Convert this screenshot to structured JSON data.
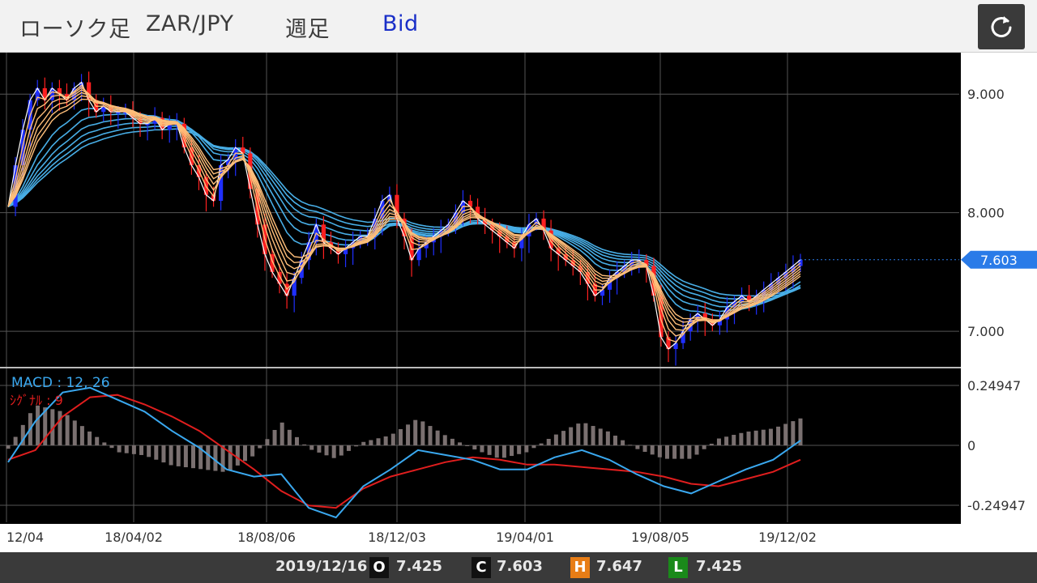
{
  "header": {
    "chart_type": "ローソク足",
    "pair": "ZAR/JPY",
    "period": "週足",
    "side": "Bid"
  },
  "colors": {
    "up_candle": "#1f2fff",
    "down_candle": "#ff2020",
    "fast_ema": "#ffbf7a",
    "slow_ema": "#48aee6",
    "macd_line": "#3aa8ef",
    "signal_line": "#e01e1e",
    "histogram": "#7a7070",
    "price_tag": "#2a7be8"
  },
  "chart_data": [
    {
      "type": "candlestick",
      "x_tick_labels": [
        "12/04",
        "18/04/02",
        "18/08/06",
        "18/12/03",
        "19/04/01",
        "19/08/05",
        "19/12/02"
      ],
      "y_ticks": [
        7.0,
        8.0,
        9.0
      ],
      "y_tick_labels": [
        "7.000",
        "8.000",
        "9.000"
      ],
      "ylim": [
        6.7,
        9.35
      ],
      "current_price": 7.603,
      "current_price_label": "7.603",
      "overlays": [
        "short-term EMAs (orange ribbon)",
        "long-term EMAs (blue ribbon)"
      ],
      "close_path": [
        8.05,
        8.4,
        8.7,
        8.95,
        9.05,
        8.95,
        9.05,
        9.0,
        8.95,
        9.05,
        9.1,
        8.95,
        8.85,
        8.9,
        8.85,
        8.85,
        8.85,
        8.8,
        8.75,
        8.75,
        8.8,
        8.7,
        8.75,
        8.75,
        8.55,
        8.4,
        8.3,
        8.15,
        8.1,
        8.4,
        8.45,
        8.55,
        8.5,
        8.2,
        7.9,
        7.65,
        7.5,
        7.4,
        7.3,
        7.45,
        7.6,
        7.75,
        7.9,
        7.75,
        7.7,
        7.65,
        7.7,
        7.75,
        7.8,
        7.8,
        7.95,
        8.1,
        8.15,
        7.95,
        7.8,
        7.6,
        7.7,
        7.75,
        7.8,
        7.85,
        7.9,
        8.0,
        8.1,
        8.05,
        7.95,
        7.9,
        7.85,
        7.8,
        7.75,
        7.7,
        7.8,
        7.9,
        7.95,
        7.85,
        7.7,
        7.65,
        7.6,
        7.55,
        7.5,
        7.4,
        7.3,
        7.35,
        7.45,
        7.5,
        7.55,
        7.6,
        7.6,
        7.55,
        7.3,
        6.95,
        6.85,
        6.9,
        7.0,
        7.1,
        7.15,
        7.1,
        7.05,
        7.1,
        7.2,
        7.25,
        7.3,
        7.25,
        7.3,
        7.35,
        7.4,
        7.45,
        7.5,
        7.55,
        7.603
      ]
    },
    {
      "type": "line",
      "title": "MACD : 12, 26",
      "signal_label": "ｼｸﾞﾅﾙ : 9",
      "y_ticks": [
        0.24947,
        0,
        -0.24947
      ],
      "y_tick_labels": [
        "0.24947",
        "0",
        "-0.24947"
      ],
      "ylim": [
        -0.32,
        0.32
      ],
      "series": [
        {
          "name": "MACD",
          "values": [
            -0.07,
            0.1,
            0.22,
            0.24,
            0.19,
            0.14,
            0.06,
            -0.01,
            -0.1,
            -0.13,
            -0.12,
            -0.26,
            -0.3,
            -0.17,
            -0.1,
            -0.02,
            -0.04,
            -0.06,
            -0.1,
            -0.1,
            -0.05,
            -0.02,
            -0.06,
            -0.12,
            -0.17,
            -0.2,
            -0.15,
            -0.1,
            -0.06,
            0.02
          ]
        },
        {
          "name": "シグナル",
          "values": [
            -0.06,
            -0.02,
            0.12,
            0.2,
            0.21,
            0.17,
            0.12,
            0.06,
            -0.02,
            -0.1,
            -0.19,
            -0.25,
            -0.26,
            -0.18,
            -0.13,
            -0.1,
            -0.07,
            -0.05,
            -0.06,
            -0.08,
            -0.08,
            -0.09,
            -0.1,
            -0.11,
            -0.13,
            -0.16,
            -0.17,
            -0.14,
            -0.11,
            -0.06
          ]
        }
      ]
    }
  ],
  "footer": {
    "date": "2019/12/16",
    "open_badge": "O",
    "open": "7.425",
    "close_badge": "C",
    "close": "7.603",
    "high_badge": "H",
    "high": "7.647",
    "low_badge": "L",
    "low": "7.425"
  }
}
